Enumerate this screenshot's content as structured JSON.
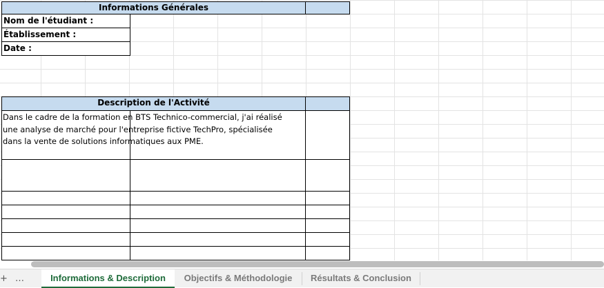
{
  "section1": {
    "header": "Informations Générales",
    "labels": [
      "Nom de l'étudiant :",
      "Établissement :",
      "Date :"
    ]
  },
  "section2": {
    "header": "Description de l'Activité",
    "text": "Dans le cadre de la formation en BTS Technico-commercial, j'ai réalisé\nune analyse de marché pour l'entreprise fictive TechPro, spécialisée\ndans la vente de solutions informatiques aux PME."
  },
  "tabs": [
    {
      "label": "Informations & Description",
      "active": true
    },
    {
      "label": "Objectifs & Méthodologie",
      "active": false
    },
    {
      "label": "Résultats & Conclusion",
      "active": false
    }
  ],
  "toolbar": {
    "add_icon": "plus-icon",
    "more_icon": "more-icon",
    "add_glyph": "+",
    "more_glyph": "…"
  },
  "colors": {
    "header_bg": "#c6dbef",
    "active_tab": "#1e6b3a"
  }
}
